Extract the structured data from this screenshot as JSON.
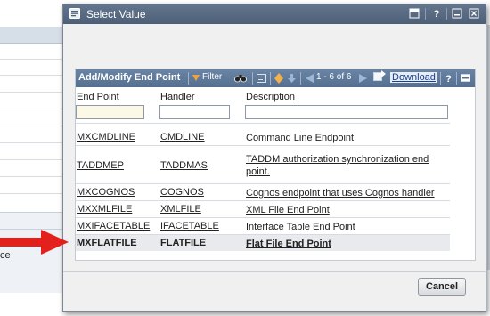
{
  "background_page": {
    "truncated_label": "ce"
  },
  "dialog": {
    "title": "Select Value",
    "controls": [
      "menu-icon",
      "help-icon",
      "minimize-icon",
      "close-icon"
    ]
  },
  "table": {
    "title": "Add/Modify End Point",
    "toolbar": {
      "filter_label": "Filter",
      "pagination": "1 - 6 of 6",
      "download_label": "Download"
    },
    "columns": [
      "End Point",
      "Handler",
      "Description"
    ],
    "filters": {
      "endpoint": "",
      "handler": "",
      "description": ""
    },
    "rows": [
      {
        "endpoint": "MXCMDLINE",
        "handler": "CMDLINE",
        "description": "Command Line Endpoint"
      },
      {
        "endpoint": "TADDMEP",
        "handler": "TADDMAS",
        "description": "TADDM authorization synchronization end point."
      },
      {
        "endpoint": "MXCOGNOS",
        "handler": "COGNOS",
        "description": "Cognos endpoint that uses Cognos handler"
      },
      {
        "endpoint": "MXXMLFILE",
        "handler": "XMLFILE",
        "description": "XML File End Point"
      },
      {
        "endpoint": "MXIFACETABLE",
        "handler": "IFACETABLE",
        "description": "Interface Table End Point"
      },
      {
        "endpoint": "MXFLATFILE",
        "handler": "FLATFILE",
        "description": "Flat File End Point"
      }
    ],
    "highlighted_row_index": 5
  },
  "footer": {
    "cancel_label": "Cancel"
  },
  "colors": {
    "titlebar": "#4c5f77",
    "toolbar": "#55708f",
    "arrow": "#e3201b",
    "highlight_row": "#e8eaed"
  }
}
